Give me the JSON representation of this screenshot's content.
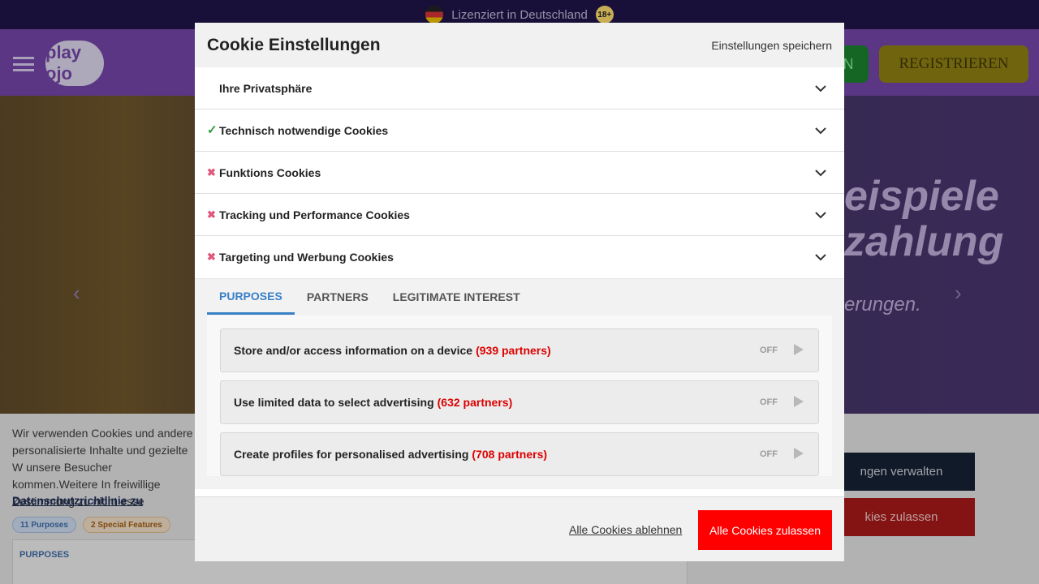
{
  "background": {
    "top_strip": {
      "text": "Lizenziert in Deutschland",
      "age_badge": "18+"
    },
    "header": {
      "logo": "play ojo",
      "login_fragment": "N",
      "register_label": "REGISTRIEREN"
    },
    "hero": {
      "line1": "eispiele",
      "line2": "zahlung",
      "sub": "erungen."
    },
    "cookie_bar": {
      "text": "Wir verwenden Cookies und andere personalisierte Inhalte und gezielte W unsere Besucher kommen.Weitere In freiwillige Zustimmung zu nicht esse",
      "link": "Datenschutzrichtlinie zu",
      "chip_purposes": "11 Purposes",
      "chip_special": "2 Special Features",
      "purposes_heading": "PURPOSES",
      "manage_button": "ngen verwalten",
      "accept_button": "kies zulassen"
    }
  },
  "modal": {
    "title": "Cookie Einstellungen",
    "save_link": "Einstellungen speichern",
    "sections": [
      {
        "label": "Ihre Privatsphäre",
        "status": "none"
      },
      {
        "label": "Technisch notwendige Cookies",
        "status": "enabled",
        "icon": "check-icon"
      },
      {
        "label": "Funktions Cookies",
        "status": "disabled",
        "icon": "cross-icon"
      },
      {
        "label": "Tracking und Performance Cookies",
        "status": "disabled",
        "icon": "cross-icon"
      },
      {
        "label": "Targeting und Werbung Cookies",
        "status": "disabled",
        "icon": "cross-icon"
      }
    ],
    "tabs": [
      "PURPOSES",
      "PARTNERS",
      "LEGITIMATE INTEREST"
    ],
    "active_tab": "PURPOSES",
    "purposes": [
      {
        "label": "Store and/or access information on a device",
        "partners": "(939 partners)",
        "state": "OFF"
      },
      {
        "label": "Use limited data to select advertising",
        "partners": "(632 partners)",
        "state": "OFF"
      },
      {
        "label": "Create profiles for personalised advertising",
        "partners": "(708 partners)",
        "state": "OFF"
      }
    ],
    "footer": {
      "reject_label": "Alle Cookies ablehnen",
      "accept_label": "Alle Cookies zulassen"
    },
    "colors": {
      "accent_tab": "#3a80c6",
      "accept": "#ff0000",
      "partners": "#dd0000",
      "check": "#2e9a3a",
      "cross": "#e0577a"
    }
  }
}
